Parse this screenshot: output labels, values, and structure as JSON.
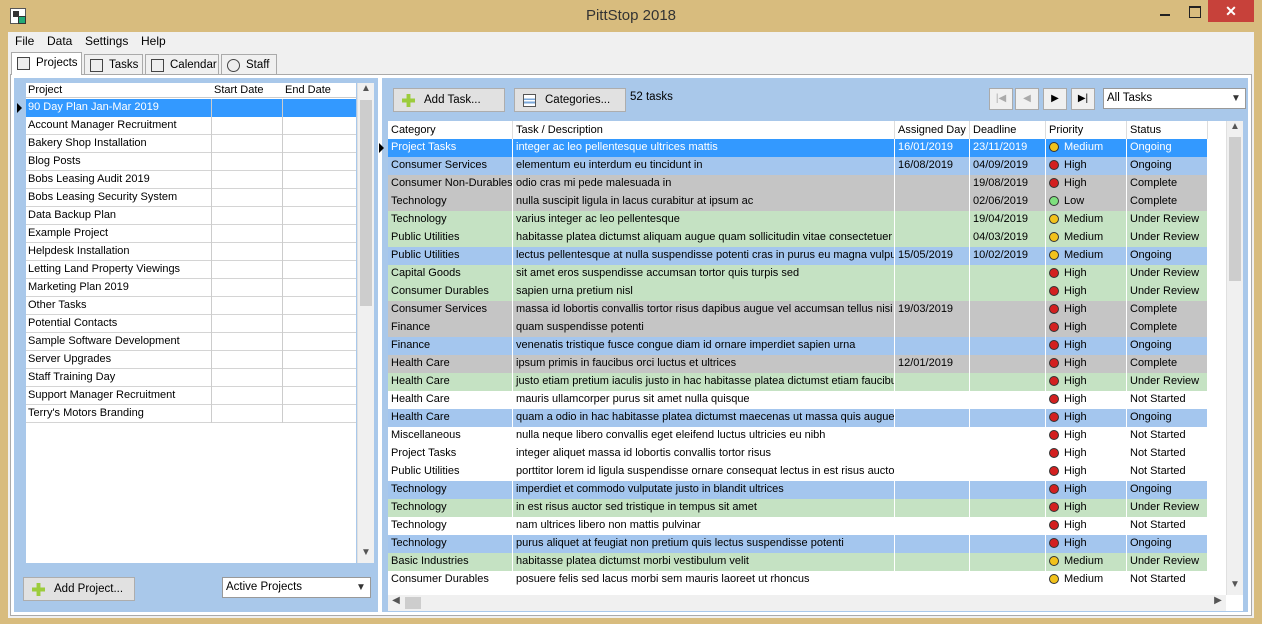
{
  "window": {
    "title": "PittStop 2018"
  },
  "window_controls": {
    "close": "✕"
  },
  "menu": [
    "File",
    "Data",
    "Settings",
    "Help"
  ],
  "tabs": [
    "Projects",
    "Tasks",
    "Calendar",
    "Staff"
  ],
  "projects": {
    "columns": [
      "Project",
      "Start Date",
      "End Date"
    ],
    "rows": [
      "90 Day Plan Jan-Mar 2019",
      "Account Manager Recruitment",
      "Bakery Shop Installation",
      "Blog Posts",
      "Bobs Leasing Audit 2019",
      "Bobs Leasing Security System",
      "Data Backup Plan",
      "Example Project",
      "Helpdesk Installation",
      "Letting Land Property Viewings",
      "Marketing Plan 2019",
      "Other Tasks",
      "Potential Contacts",
      "Sample Software Development",
      "Server Upgrades",
      "Staff Training Day",
      "Support Manager Recruitment",
      "Terry's Motors Branding"
    ],
    "selected_index": 0,
    "add_button": "Add Project...",
    "filter": "Active Projects"
  },
  "tasks": {
    "add_button": "Add Task...",
    "categories_button": "Categories...",
    "count_label": "52 tasks",
    "filter": "All Tasks",
    "nav": {
      "first": "|◀",
      "prev": "◀",
      "next": "▶",
      "last": "▶|"
    },
    "columns": [
      "Category",
      "Task / Description",
      "Assigned Day",
      "Deadline",
      "Priority",
      "Status"
    ],
    "row_colors": {
      "blue": "#a4c6ee",
      "green": "#c5e2c3",
      "grey": "#c5c5c5",
      "white": "#ffffff",
      "selected": "#3399ff"
    },
    "priority_colors": {
      "High": "#d32020",
      "Medium": "#f2c21b",
      "Low": "#7ee07e"
    },
    "rows": [
      {
        "category": "Project Tasks",
        "description": "integer ac leo pellentesque ultrices mattis",
        "assigned": "16/01/2019",
        "deadline": "23/11/2019",
        "priority": "Medium",
        "status": "Ongoing",
        "color": "selected"
      },
      {
        "category": "Consumer Services",
        "description": "elementum eu interdum eu tincidunt in",
        "assigned": "16/08/2019",
        "deadline": "04/09/2019",
        "priority": "High",
        "status": "Ongoing",
        "color": "blue"
      },
      {
        "category": "Consumer Non-Durables",
        "description": "odio cras mi pede malesuada in",
        "assigned": "",
        "deadline": "19/08/2019",
        "priority": "High",
        "status": "Complete",
        "color": "grey"
      },
      {
        "category": "Technology",
        "description": "nulla suscipit ligula in lacus curabitur at ipsum ac",
        "assigned": "",
        "deadline": "02/06/2019",
        "priority": "Low",
        "status": "Complete",
        "color": "grey"
      },
      {
        "category": "Technology",
        "description": "varius integer ac leo pellentesque",
        "assigned": "",
        "deadline": "19/04/2019",
        "priority": "Medium",
        "status": "Under Review",
        "color": "green"
      },
      {
        "category": "Public Utilities",
        "description": "habitasse platea dictumst aliquam augue quam sollicitudin vitae consectetuer eg",
        "assigned": "",
        "deadline": "04/03/2019",
        "priority": "Medium",
        "status": "Under Review",
        "color": "green"
      },
      {
        "category": "Public Utilities",
        "description": "lectus pellentesque at nulla suspendisse potenti cras in purus eu magna vulputa",
        "assigned": "15/05/2019",
        "deadline": "10/02/2019",
        "priority": "Medium",
        "status": "Ongoing",
        "color": "blue"
      },
      {
        "category": "Capital Goods",
        "description": "sit amet eros suspendisse accumsan tortor quis turpis sed",
        "assigned": "",
        "deadline": "",
        "priority": "High",
        "status": "Under Review",
        "color": "green"
      },
      {
        "category": "Consumer Durables",
        "description": "sapien urna pretium nisl",
        "assigned": "",
        "deadline": "",
        "priority": "High",
        "status": "Under Review",
        "color": "green"
      },
      {
        "category": "Consumer Services",
        "description": "massa id lobortis convallis tortor risus dapibus augue vel accumsan tellus nisi eu",
        "assigned": "19/03/2019",
        "deadline": "",
        "priority": "High",
        "status": "Complete",
        "color": "grey"
      },
      {
        "category": "Finance",
        "description": "quam suspendisse potenti",
        "assigned": "",
        "deadline": "",
        "priority": "High",
        "status": "Complete",
        "color": "grey"
      },
      {
        "category": "Finance",
        "description": "venenatis tristique fusce congue diam id ornare imperdiet sapien urna",
        "assigned": "",
        "deadline": "",
        "priority": "High",
        "status": "Ongoing",
        "color": "blue"
      },
      {
        "category": "Health Care",
        "description": "ipsum primis in faucibus orci luctus et ultrices",
        "assigned": "12/01/2019",
        "deadline": "",
        "priority": "High",
        "status": "Complete",
        "color": "grey"
      },
      {
        "category": "Health Care",
        "description": "justo etiam pretium iaculis justo in hac habitasse platea dictumst etiam faucibus",
        "assigned": "",
        "deadline": "",
        "priority": "High",
        "status": "Under Review",
        "color": "green"
      },
      {
        "category": "Health Care",
        "description": "mauris ullamcorper purus sit amet nulla quisque",
        "assigned": "",
        "deadline": "",
        "priority": "High",
        "status": "Not Started",
        "color": "white"
      },
      {
        "category": "Health Care",
        "description": "quam a odio in hac habitasse platea dictumst maecenas ut massa quis augue",
        "assigned": "",
        "deadline": "",
        "priority": "High",
        "status": "Ongoing",
        "color": "blue"
      },
      {
        "category": "Miscellaneous",
        "description": "nulla neque libero convallis eget eleifend luctus ultricies eu nibh",
        "assigned": "",
        "deadline": "",
        "priority": "High",
        "status": "Not Started",
        "color": "white"
      },
      {
        "category": "Project Tasks",
        "description": "integer aliquet massa id lobortis convallis tortor risus",
        "assigned": "",
        "deadline": "",
        "priority": "High",
        "status": "Not Started",
        "color": "white"
      },
      {
        "category": "Public Utilities",
        "description": "porttitor lorem id ligula suspendisse ornare consequat lectus in est risus auctor",
        "assigned": "",
        "deadline": "",
        "priority": "High",
        "status": "Not Started",
        "color": "white"
      },
      {
        "category": "Technology",
        "description": "imperdiet et commodo vulputate justo in blandit ultrices",
        "assigned": "",
        "deadline": "",
        "priority": "High",
        "status": "Ongoing",
        "color": "blue"
      },
      {
        "category": "Technology",
        "description": "in est risus auctor sed tristique in tempus sit amet",
        "assigned": "",
        "deadline": "",
        "priority": "High",
        "status": "Under Review",
        "color": "green"
      },
      {
        "category": "Technology",
        "description": "nam ultrices libero non mattis pulvinar",
        "assigned": "",
        "deadline": "",
        "priority": "High",
        "status": "Not Started",
        "color": "white"
      },
      {
        "category": "Technology",
        "description": "purus aliquet at feugiat non pretium quis lectus suspendisse potenti",
        "assigned": "",
        "deadline": "",
        "priority": "High",
        "status": "Ongoing",
        "color": "blue"
      },
      {
        "category": "Basic Industries",
        "description": "habitasse platea dictumst morbi vestibulum velit",
        "assigned": "",
        "deadline": "",
        "priority": "Medium",
        "status": "Under Review",
        "color": "green"
      },
      {
        "category": "Consumer Durables",
        "description": "posuere felis sed lacus morbi sem mauris laoreet ut rhoncus",
        "assigned": "",
        "deadline": "",
        "priority": "Medium",
        "status": "Not Started",
        "color": "white"
      }
    ]
  }
}
